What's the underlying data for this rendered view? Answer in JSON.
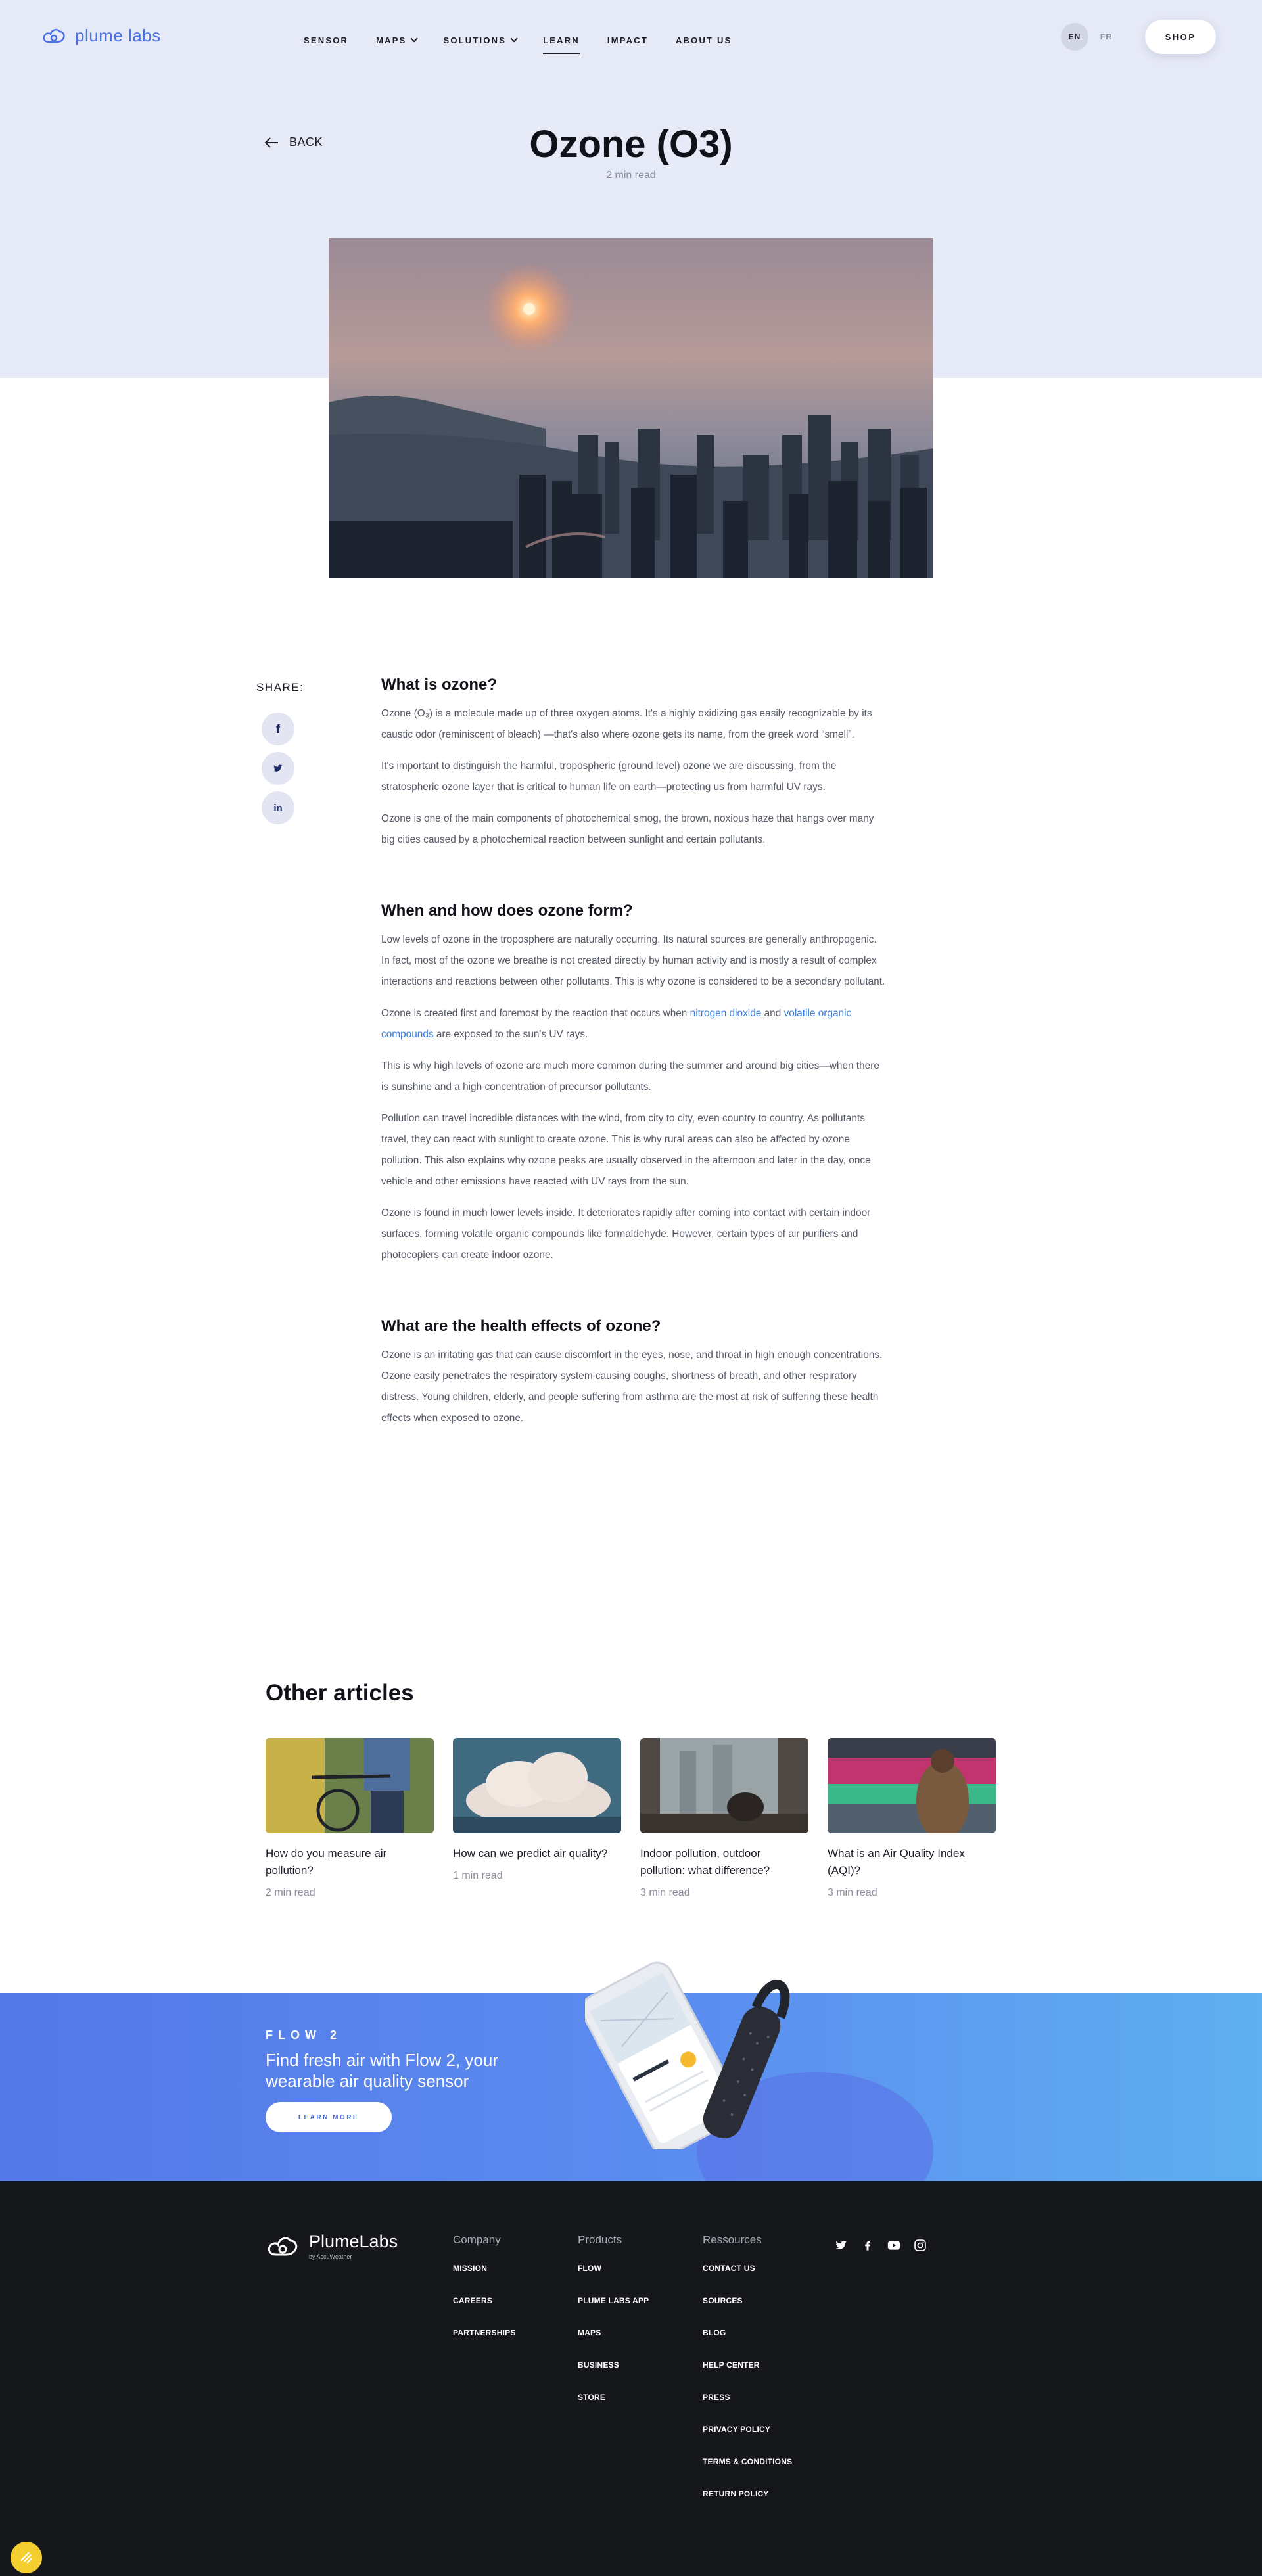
{
  "header": {
    "logo_text": "plume labs",
    "nav": [
      {
        "label": "SENSOR",
        "dropdown": false,
        "active": false
      },
      {
        "label": "MAPS",
        "dropdown": true,
        "active": false
      },
      {
        "label": "SOLUTIONS",
        "dropdown": true,
        "active": false
      },
      {
        "label": "LEARN",
        "dropdown": false,
        "active": true
      },
      {
        "label": "IMPACT",
        "dropdown": false,
        "active": false
      },
      {
        "label": "ABOUT US",
        "dropdown": false,
        "active": false
      }
    ],
    "lang_en": "EN",
    "lang_fr": "FR",
    "shop_label": "SHOP"
  },
  "page": {
    "back_label": "BACK",
    "title": "Ozone (O3)",
    "read_time": "2 min read"
  },
  "share": {
    "label": "SHARE:",
    "facebook": "f",
    "twitter": "t",
    "linkedin": "in"
  },
  "article": {
    "sections": [
      {
        "heading": "What is ozone?",
        "paragraphs": [
          "Ozone (O₃) is a molecule made up of three oxygen atoms. It's a highly oxidizing gas easily recognizable by its caustic odor (reminiscent of bleach) —that's also where ozone gets its name, from the greek word “smell”.",
          "It's important to distinguish the harmful, tropospheric (ground level) ozone we are discussing, from the stratospheric ozone layer that is critical to human life on earth—protecting us from harmful UV rays.",
          "Ozone is one of the main components of photochemical smog, the brown, noxious haze that hangs over many big cities caused by a photochemical reaction between sunlight and certain pollutants."
        ]
      },
      {
        "heading": "When and how does ozone form?",
        "paragraphs": [
          "Low levels of ozone in the troposphere are naturally occurring. Its natural sources are generally anthropogenic. In fact, most of the ozone we breathe is not created directly by human activity and is mostly a result of complex interactions and reactions between other pollutants. This is why ozone is considered to be a secondary pollutant.",
          "This is why high levels of ozone are much more common during the summer and around big cities—when there is sunshine and a high concentration of precursor pollutants.",
          "Pollution can travel incredible distances with the wind, from city to city, even country to country. As pollutants travel, they can react with sunlight to create ozone. This is why rural areas can also be affected by ozone pollution. This also explains why ozone peaks are usually observed in the afternoon and later in the day, once vehicle and other emissions have reacted with UV rays from the sun.",
          "Ozone is found in much lower levels inside. It deteriorates rapidly after coming into contact with certain indoor surfaces, forming volatile organic compounds like formaldehyde. However, certain types of air purifiers and photocopiers can create indoor ozone."
        ],
        "link_para": {
          "before": "Ozone is created first and foremost by the reaction that occurs when ",
          "link1": "nitrogen dioxide",
          "middle": " and ",
          "link2": "volatile organic compounds",
          "after": " are exposed to the sun's UV rays."
        }
      },
      {
        "heading": "What are the health effects of ozone?",
        "paragraphs": [
          "Ozone is an irritating gas that can cause discomfort in the eyes, nose, and throat in high enough concentrations. Ozone easily penetrates the respiratory system causing coughs, shortness of breath, and other respiratory distress. Young children, elderly, and people suffering from asthma are the most at risk of suffering these health effects when exposed to ozone."
        ]
      }
    ]
  },
  "other_articles": {
    "heading": "Other articles",
    "items": [
      {
        "title": "How do you measure air pollution?",
        "read_time": "2 min read"
      },
      {
        "title": "How can we predict air quality?",
        "read_time": "1 min read"
      },
      {
        "title": "Indoor pollution, outdoor pollution: what difference?",
        "read_time": "3 min read"
      },
      {
        "title": "What is an Air Quality Index (AQI)?",
        "read_time": "3 min read"
      }
    ]
  },
  "banner": {
    "eyebrow": "FLOW 2",
    "headline": "Find fresh air with Flow 2, your wearable air quality sensor",
    "button": "LEARN MORE"
  },
  "footer": {
    "logo_name": "PlumeLabs",
    "logo_sub": "by AccuWeather",
    "columns": [
      {
        "heading": "Company",
        "items": [
          "MISSION",
          "CAREERS",
          "PARTNERSHIPS"
        ]
      },
      {
        "heading": "Products",
        "items": [
          "FLOW",
          "PLUME LABS APP",
          "MAPS",
          "BUSINESS",
          "STORE"
        ]
      },
      {
        "heading": "Ressources",
        "items": [
          "CONTACT US",
          "SOURCES",
          "BLOG",
          "HELP CENTER",
          "PRESS",
          "PRIVACY POLICY",
          "TERMS & CONDITIONS",
          "RETURN POLICY"
        ]
      }
    ],
    "socials": [
      "twitter-icon",
      "facebook-icon",
      "youtube-icon",
      "instagram-icon"
    ]
  },
  "colors": {
    "brand_blue": "#4a72e6",
    "hero_bg": "#e6e9f6",
    "footer_bg": "#16171b",
    "link": "#3a7fe0"
  }
}
